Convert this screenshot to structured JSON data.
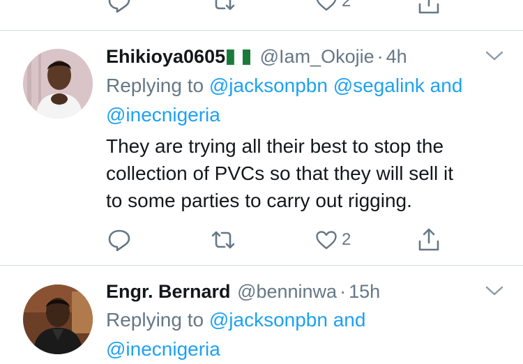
{
  "top_actions": {
    "like_count": "2"
  },
  "tweets": [
    {
      "display_name": "Ehikioya0605",
      "flag_icon": "nigeria-flag-icon",
      "handle": "@Iam_Okojie",
      "dot": "·",
      "time": "4h",
      "replying_prefix": "Replying to",
      "mention_1": "@jacksonpbn",
      "mention_2": "@segalink",
      "and": "and",
      "mention_3": "@inecnigeria",
      "text_line_1": "They are trying all their best to stop the",
      "text_line_2": "collection of PVCs so that they will sell it",
      "text_line_3": "to some parties to carry out rigging.",
      "like_count": "2"
    },
    {
      "display_name": "Engr. Bernard",
      "handle": "@benninwa",
      "dot": "·",
      "time": "15h",
      "replying_prefix": "Replying to",
      "mention_1": "@jacksonpbn",
      "and": "and",
      "mention_2": "@inecnigeria"
    }
  ],
  "colors": {
    "link": "#1da1f2",
    "secondary": "#657786",
    "divider": "#d6dbdf"
  }
}
